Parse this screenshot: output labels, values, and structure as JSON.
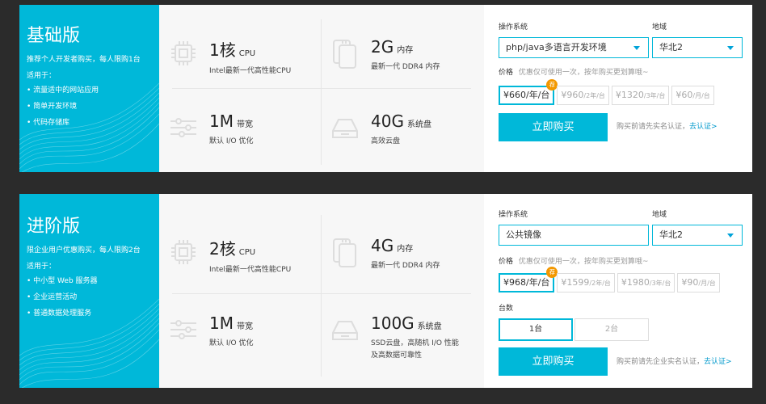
{
  "cards": [
    {
      "promo": {
        "title": "基础版",
        "subtitle": "推荐个人开发者购买，每人限购1台",
        "suitable": "适用于：",
        "items": [
          "流量适中的网站应用",
          "简单开发环境",
          "代码存储库"
        ]
      },
      "specs": {
        "cpu": {
          "value": "1核",
          "unit": "CPU",
          "desc": "Intel最新一代高性能CPU"
        },
        "mem": {
          "value": "2G",
          "unit": "内存",
          "desc": "最新一代 DDR4 内存"
        },
        "bw": {
          "value": "1M",
          "unit": "带宽",
          "desc": "默认 I/O 优化"
        },
        "disk": {
          "value": "40G",
          "unit": "系统盘",
          "desc": "高效云盘",
          "desc2": ""
        }
      },
      "config": {
        "os_label": "操作系统",
        "os_value": "php/java多语言开发环境",
        "region_label": "地域",
        "region_value": "华北2",
        "price_label": "价格",
        "price_hint": "优惠仅可使用一次，按年购买更划算哦~",
        "prices": [
          {
            "main": "¥660/年/台",
            "suffix": ""
          },
          {
            "main": "¥960",
            "suffix": "/2年/台"
          },
          {
            "main": "¥1320",
            "suffix": "/3年/台"
          },
          {
            "main": "¥60",
            "suffix": "/月/台"
          }
        ],
        "badge": "荐",
        "buy_label": "立即购买",
        "note": "购买前请先实名认证，",
        "note_link": "去认证>"
      }
    },
    {
      "promo": {
        "title": "进阶版",
        "subtitle": "限企业用户优惠购买，每人限购2台",
        "suitable": "适用于：",
        "items": [
          "中小型 Web 服务器",
          "企业运营活动",
          "普通数据处理服务"
        ]
      },
      "specs": {
        "cpu": {
          "value": "2核",
          "unit": "CPU",
          "desc": "Intel最新一代高性能CPU"
        },
        "mem": {
          "value": "4G",
          "unit": "内存",
          "desc": "最新一代 DDR4 内存"
        },
        "bw": {
          "value": "1M",
          "unit": "带宽",
          "desc": "默认 I/O 优化"
        },
        "disk": {
          "value": "100G",
          "unit": "系统盘",
          "desc": "SSD云盘，高随机 I/O 性能",
          "desc2": "及高数据可靠性"
        }
      },
      "config": {
        "os_label": "操作系统",
        "os_value": "公共镜像",
        "region_label": "地域",
        "region_value": "华北2",
        "price_label": "价格",
        "price_hint": "优惠仅可使用一次，按年购买更划算哦~",
        "prices": [
          {
            "main": "¥968/年/台",
            "suffix": ""
          },
          {
            "main": "¥1599",
            "suffix": "/2年/台"
          },
          {
            "main": "¥1980",
            "suffix": "/3年/台"
          },
          {
            "main": "¥90",
            "suffix": "/月/台"
          }
        ],
        "badge": "荐",
        "qty_label": "台数",
        "qty": [
          "1台",
          "2台"
        ],
        "buy_label": "立即购买",
        "note": "购买前请先企业实名认证，",
        "note_link": "去认证>"
      }
    }
  ],
  "colors": {
    "accent": "#00b8d9",
    "badge": "#f39800",
    "bg": "#2b2b2b"
  }
}
